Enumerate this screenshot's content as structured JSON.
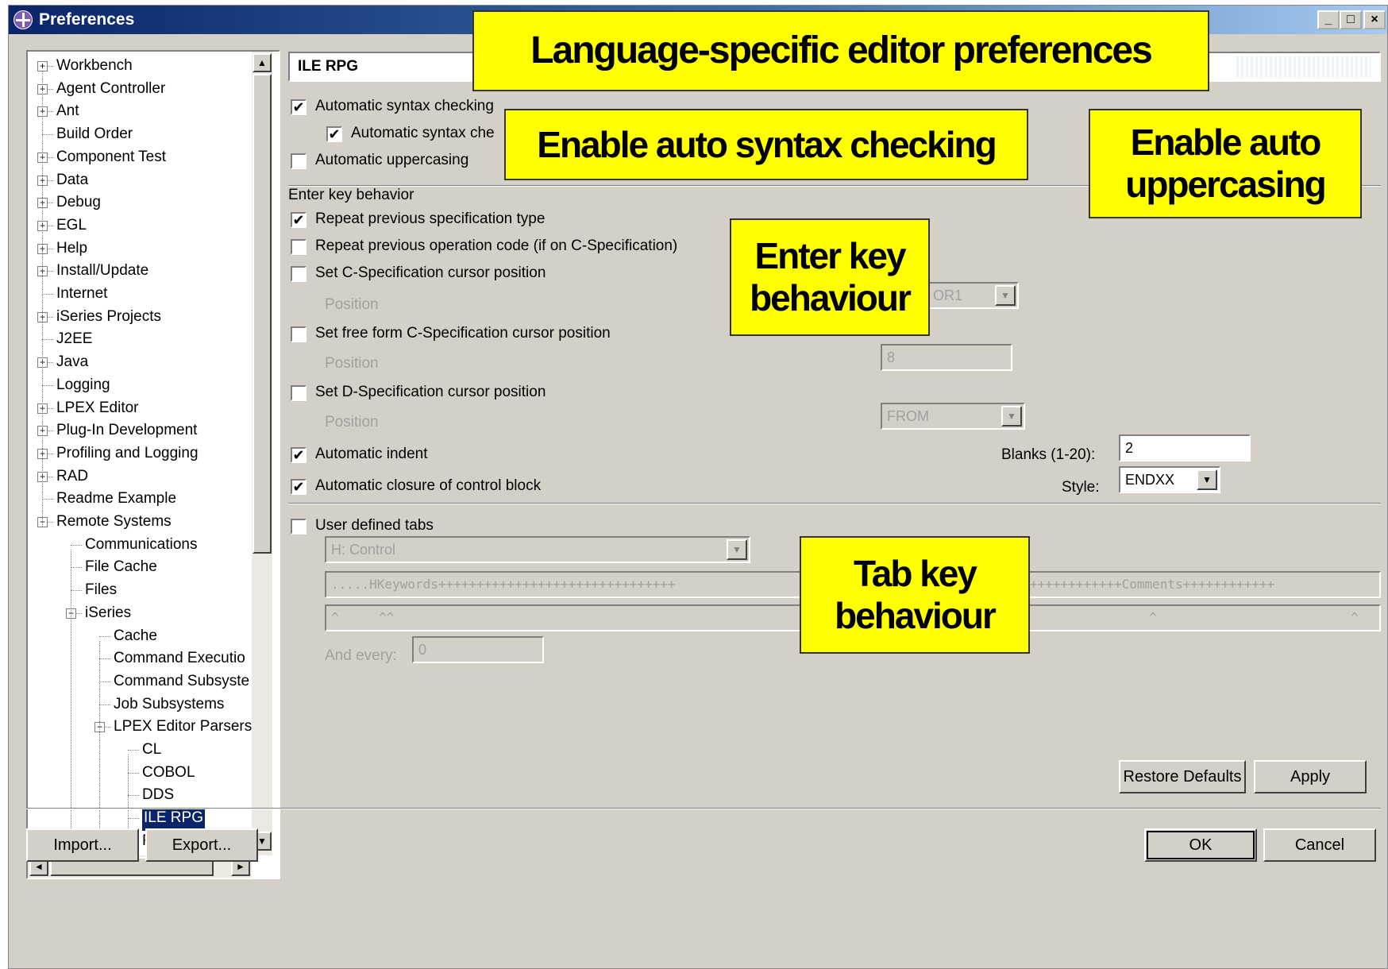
{
  "window": {
    "title": "Preferences",
    "controls": {
      "minimize": "_",
      "maximize": "□",
      "close": "×"
    }
  },
  "tree": [
    {
      "label": "Workbench",
      "level": 0,
      "expander": "+"
    },
    {
      "label": "Agent Controller",
      "level": 0,
      "expander": "+"
    },
    {
      "label": "Ant",
      "level": 0,
      "expander": "+"
    },
    {
      "label": "Build Order",
      "level": 0,
      "expander": ""
    },
    {
      "label": "Component Test",
      "level": 0,
      "expander": "+"
    },
    {
      "label": "Data",
      "level": 0,
      "expander": "+"
    },
    {
      "label": "Debug",
      "level": 0,
      "expander": "+"
    },
    {
      "label": "EGL",
      "level": 0,
      "expander": "+"
    },
    {
      "label": "Help",
      "level": 0,
      "expander": "+"
    },
    {
      "label": "Install/Update",
      "level": 0,
      "expander": "+"
    },
    {
      "label": "Internet",
      "level": 0,
      "expander": ""
    },
    {
      "label": "iSeries Projects",
      "level": 0,
      "expander": "+"
    },
    {
      "label": "J2EE",
      "level": 0,
      "expander": ""
    },
    {
      "label": "Java",
      "level": 0,
      "expander": "+"
    },
    {
      "label": "Logging",
      "level": 0,
      "expander": ""
    },
    {
      "label": "LPEX Editor",
      "level": 0,
      "expander": "+"
    },
    {
      "label": "Plug-In Development",
      "level": 0,
      "expander": "+"
    },
    {
      "label": "Profiling and Logging",
      "level": 0,
      "expander": "+"
    },
    {
      "label": "RAD",
      "level": 0,
      "expander": "+"
    },
    {
      "label": "Readme Example",
      "level": 0,
      "expander": ""
    },
    {
      "label": "Remote Systems",
      "level": 0,
      "expander": "−"
    },
    {
      "label": "Communications",
      "level": 1,
      "expander": ""
    },
    {
      "label": "File Cache",
      "level": 1,
      "expander": ""
    },
    {
      "label": "Files",
      "level": 1,
      "expander": ""
    },
    {
      "label": "iSeries",
      "level": 1,
      "expander": "−"
    },
    {
      "label": "Cache",
      "level": 2,
      "expander": ""
    },
    {
      "label": "Command Executio",
      "level": 2,
      "expander": ""
    },
    {
      "label": "Command Subsyste",
      "level": 2,
      "expander": ""
    },
    {
      "label": "Job Subsystems",
      "level": 2,
      "expander": ""
    },
    {
      "label": "LPEX Editor Parsers",
      "level": 2,
      "expander": "−"
    },
    {
      "label": "CL",
      "level": 3,
      "expander": ""
    },
    {
      "label": "COBOL",
      "level": 3,
      "expander": ""
    },
    {
      "label": "DDS",
      "level": 3,
      "expander": ""
    },
    {
      "label": "ILE RPG",
      "level": 3,
      "expander": "",
      "selected": true
    },
    {
      "label": "RPG/400",
      "level": 3,
      "expander": ""
    }
  ],
  "scroll_glyphs": {
    "up": "▲",
    "down": "▼",
    "left": "◄",
    "right": "►",
    "dropdown": "▼"
  },
  "panel": {
    "title": "ILE RPG",
    "auto_syntax": {
      "label": "Automatic syntax checking",
      "checked": true
    },
    "auto_syntax_sub": {
      "label": "Automatic syntax che",
      "checked": true
    },
    "auto_upper": {
      "label": "Automatic uppercasing",
      "checked": false
    },
    "enter_heading": "Enter key behavior",
    "repeat_spec": {
      "label": "Repeat previous specification type",
      "checked": true
    },
    "repeat_op": {
      "label": "Repeat previous operation code (if on C-Specification)",
      "checked": false
    },
    "c_spec": {
      "label": "Set C-Specification cursor position",
      "checked": false
    },
    "c_spec_pos_label": "Position",
    "c_spec_pos_value": "OR1",
    "free_spec": {
      "label": "Set free form C-Specification cursor position",
      "checked": false
    },
    "free_spec_pos_label": "Position",
    "free_spec_pos_value": "8",
    "d_spec": {
      "label": "Set D-Specification cursor position",
      "checked": false
    },
    "d_spec_pos_label": "Position",
    "d_spec_pos_value": "FROM",
    "auto_indent": {
      "label": "Automatic indent",
      "checked": true
    },
    "blanks_label": "Blanks (1-20):",
    "blanks_value": "2",
    "auto_close": {
      "label": "Automatic closure of control block",
      "checked": true
    },
    "style_label": "Style:",
    "style_value": "ENDXX",
    "user_tabs": {
      "label": "User defined tabs",
      "checked": false
    },
    "tabs_spec_value": "H: Control",
    "ruler_left": ".....HKeywords+++++++++++++++++++++++++++++++",
    "ruler_right": "++++++++++++Comments++++++++++++",
    "caret_row": [
      "^",
      "^^",
      "^",
      "^"
    ],
    "and_every_label": "And every:",
    "and_every_value": "0",
    "check_mark": "✔"
  },
  "buttons": {
    "restore_defaults": "Restore Defaults",
    "apply": "Apply",
    "import": "Import...",
    "export": "Export...",
    "ok": "OK",
    "cancel": "Cancel"
  },
  "callouts": {
    "lang_specific": "Language-specific editor preferences",
    "auto_syntax": "Enable auto syntax checking",
    "auto_upper": "Enable auto uppercasing",
    "enter_key": "Enter key behaviour",
    "tab_key": "Tab key behaviour"
  },
  "colors": {
    "accent": "#ffff00",
    "selection": "#0a246a",
    "dialog": "#d4d0c8"
  }
}
